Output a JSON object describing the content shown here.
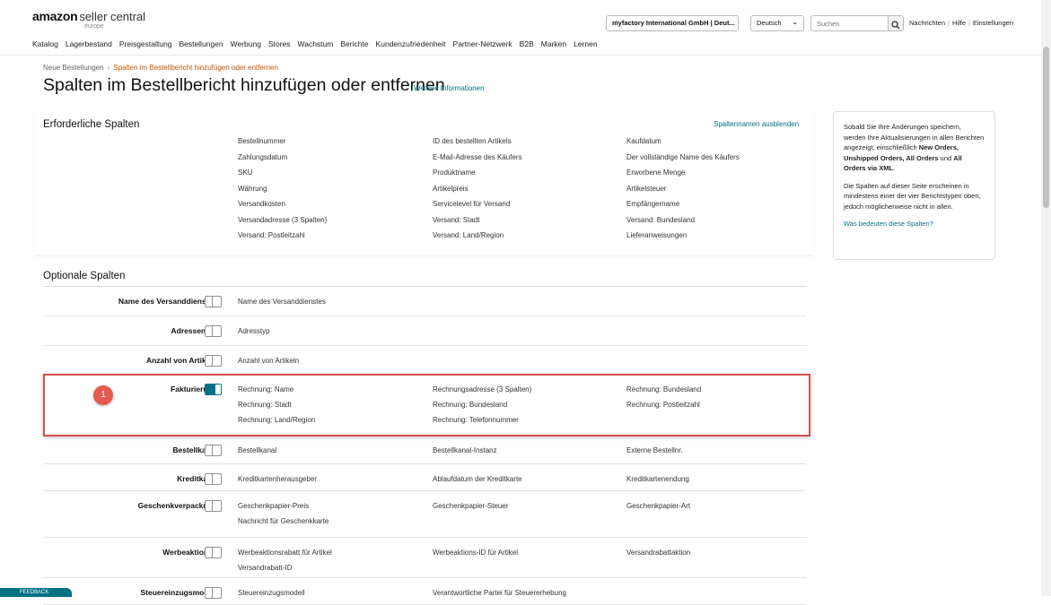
{
  "header": {
    "logo_brand": "amazon",
    "logo_product": "seller central",
    "logo_region": "europe",
    "account": "myfactory International GmbH | Deut...",
    "language": "Deutsch",
    "search_placeholder": "Suchen",
    "links": [
      "Nachrichten",
      "Hilfe",
      "Einstellungen"
    ]
  },
  "nav": [
    "Katalog",
    "Lagerbestand",
    "Preisgestaltung",
    "Bestellungen",
    "Werbung",
    "Stores",
    "Wachstum",
    "Berichte",
    "Kundenzufriedenheit",
    "Partner-Netzwerk",
    "B2B",
    "Marken",
    "Lernen"
  ],
  "breadcrumb": {
    "parent": "Neue Bestellungen",
    "separator": "›",
    "current": "Spalten im Bestellbericht hinzufügen oder entfernen"
  },
  "page": {
    "title": "Spalten im Bestellbericht hinzufügen oder entfernen",
    "more_info": "Weitere Informationen"
  },
  "required": {
    "title": "Erforderliche Spalten",
    "hide_link": "Spaltennamen ausblenden",
    "rows": [
      [
        "Bestellnummer",
        "ID des bestellten Artikels",
        "Kaufdatum"
      ],
      [
        "Zahlungsdatum",
        "E-Mail-Adresse des Käufers",
        "Der vollständige Name des Käufers"
      ],
      [
        "SKU",
        "Produktname",
        "Erworbene Menge"
      ],
      [
        "Währung",
        "Artikelpreis",
        "Artikelsteuer"
      ],
      [
        "Versandkosten",
        "Servicelevel für Versand",
        "Empfängername"
      ],
      [
        "Versandadresse (3 Spalten)",
        "Versand: Stadt",
        "Versand: Bundesland"
      ],
      [
        "Versand: Postleitzahl",
        "Versand: Land/Region",
        "Lieferanweisungen"
      ]
    ]
  },
  "optional": {
    "title": "Optionale Spalten",
    "rows": [
      {
        "label": "Name des Versanddienstes",
        "enabled": false,
        "cols": [
          [
            "Name des Versanddienstes"
          ],
          [],
          []
        ]
      },
      {
        "label": "Adressentyp",
        "enabled": false,
        "cols": [
          [
            "Adresstyp"
          ],
          [],
          []
        ]
      },
      {
        "label": "Anzahl von Artikeln",
        "enabled": false,
        "cols": [
          [
            "Anzahl von Artikeln"
          ],
          [],
          []
        ]
      },
      {
        "label": "Fakturierung",
        "enabled": true,
        "cols": [
          [
            "Rechnung: Name",
            "Rechnung: Stadt",
            "Rechnung: Land/Region"
          ],
          [
            "Rechnungsadresse (3 Spalten)",
            "Rechnung: Bundesland",
            "Rechnung: Telefonnummer"
          ],
          [
            "Rechnung: Bundesland",
            "Rechnung: Postleitzahl"
          ]
        ]
      },
      {
        "label": "Bestellkanal",
        "enabled": false,
        "cols": [
          [
            "Bestellkanal"
          ],
          [
            "Bestellkanal-Instanz"
          ],
          [
            "Externe Bestellnr."
          ]
        ]
      },
      {
        "label": "Kreditkarte",
        "enabled": false,
        "cols": [
          [
            "Kreditkartenherausgeber"
          ],
          [
            "Ablaufdatum der Kreditkarte"
          ],
          [
            "Kreditkartenendung"
          ]
        ]
      },
      {
        "label": "Geschenkverpackung",
        "enabled": false,
        "cols": [
          [
            "Geschenkpapier-Preis",
            "Nachricht für Geschenkkarte"
          ],
          [
            "Geschenkpapier-Steuer"
          ],
          [
            "Geschenkpapier-Art"
          ]
        ]
      },
      {
        "label": "Werbeaktionen",
        "enabled": false,
        "cols": [
          [
            "Werbeaktionsrabatt für Artikel",
            "Versandrabatt-ID"
          ],
          [
            "Werbeaktions-ID für Artikel"
          ],
          [
            "Versandrabattaktion"
          ]
        ]
      },
      {
        "label": "Steuereinzugsmodell",
        "enabled": false,
        "cols": [
          [
            "Steuereinzugsmodell"
          ],
          [
            "Verantwortliche Partei für Steuererhebung"
          ],
          []
        ]
      }
    ]
  },
  "annotation": {
    "marker": "1"
  },
  "info": {
    "p1_pre": "Sobald Sie Ihre Änderungen speichern, werden Ihre Aktualisierungen in allen Berichten angezeigt, einschließlich ",
    "p1_b1": "New Orders, Unshipped Orders, All Orders",
    "p1_mid": " und ",
    "p1_b2": "All Orders via XML",
    "p1_end": ".",
    "p2": "Die Spalten auf dieser Seite erscheinen in mindestens einer der vier Berichtstypen oben, jedoch möglicherweise nicht in allen.",
    "link": "Was bedeuten diese Spalten?"
  },
  "feedback": "FEEDBACK"
}
